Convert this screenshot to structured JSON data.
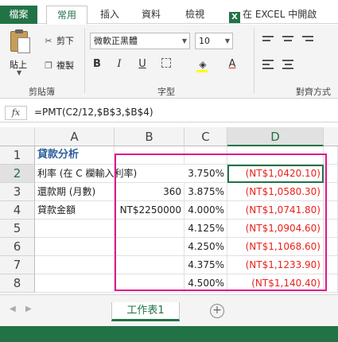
{
  "tabs": {
    "file": "檔案",
    "home": "常用",
    "insert": "插入",
    "data": "資料",
    "review": "檢視",
    "open_in_excel": "在 EXCEL 中開啟",
    "excel_icon": "X"
  },
  "clipboard": {
    "paste": "貼上",
    "cut": "剪下",
    "copy": "複製",
    "group_label": "剪貼簿"
  },
  "font": {
    "family": "微軟正黑體",
    "size": "10",
    "bold": "B",
    "italic": "I",
    "underline": "U",
    "font_color_glyph": "A",
    "group_label": "字型"
  },
  "alignment": {
    "group_label": "對齊方式"
  },
  "formula_bar": {
    "fx_label": "fx",
    "formula": "=PMT(C2/12,$B$3,$B$4)"
  },
  "columns": [
    "A",
    "B",
    "C",
    "D"
  ],
  "selected_column": "D",
  "rows": [
    {
      "num": "1",
      "a": "貸款分析",
      "b": "",
      "c": "",
      "d": ""
    },
    {
      "num": "2",
      "a": "利率 (在 C 欄輸入利率)",
      "b": "",
      "c": "3.750%",
      "d": "(NT$1,0420.10)"
    },
    {
      "num": "3",
      "a": "還款期 (月數)",
      "b": "360",
      "c": "3.875%",
      "d": "(NT$1,0580.30)"
    },
    {
      "num": "4",
      "a": "貸款金額",
      "b": "NT$2250000",
      "c": "4.000%",
      "d": "(NT$1,0741.80)"
    },
    {
      "num": "5",
      "a": "",
      "b": "",
      "c": "4.125%",
      "d": "(NT$1,0904.60)"
    },
    {
      "num": "6",
      "a": "",
      "b": "",
      "c": "4.250%",
      "d": "(NT$1,1068.60)"
    },
    {
      "num": "7",
      "a": "",
      "b": "",
      "c": "4.375%",
      "d": "(NT$1,1233.90)"
    },
    {
      "num": "8",
      "a": "",
      "b": "",
      "c": "4.500%",
      "d": "(NT$1,140.40)"
    }
  ],
  "active_cell": "D2",
  "sheet_tab": "工作表1",
  "add_sheet_glyph": "+",
  "colors": {
    "accent": "#217346",
    "highlight_border": "#e0188a",
    "negative": "#e8231b",
    "title": "#2f5f9e"
  }
}
